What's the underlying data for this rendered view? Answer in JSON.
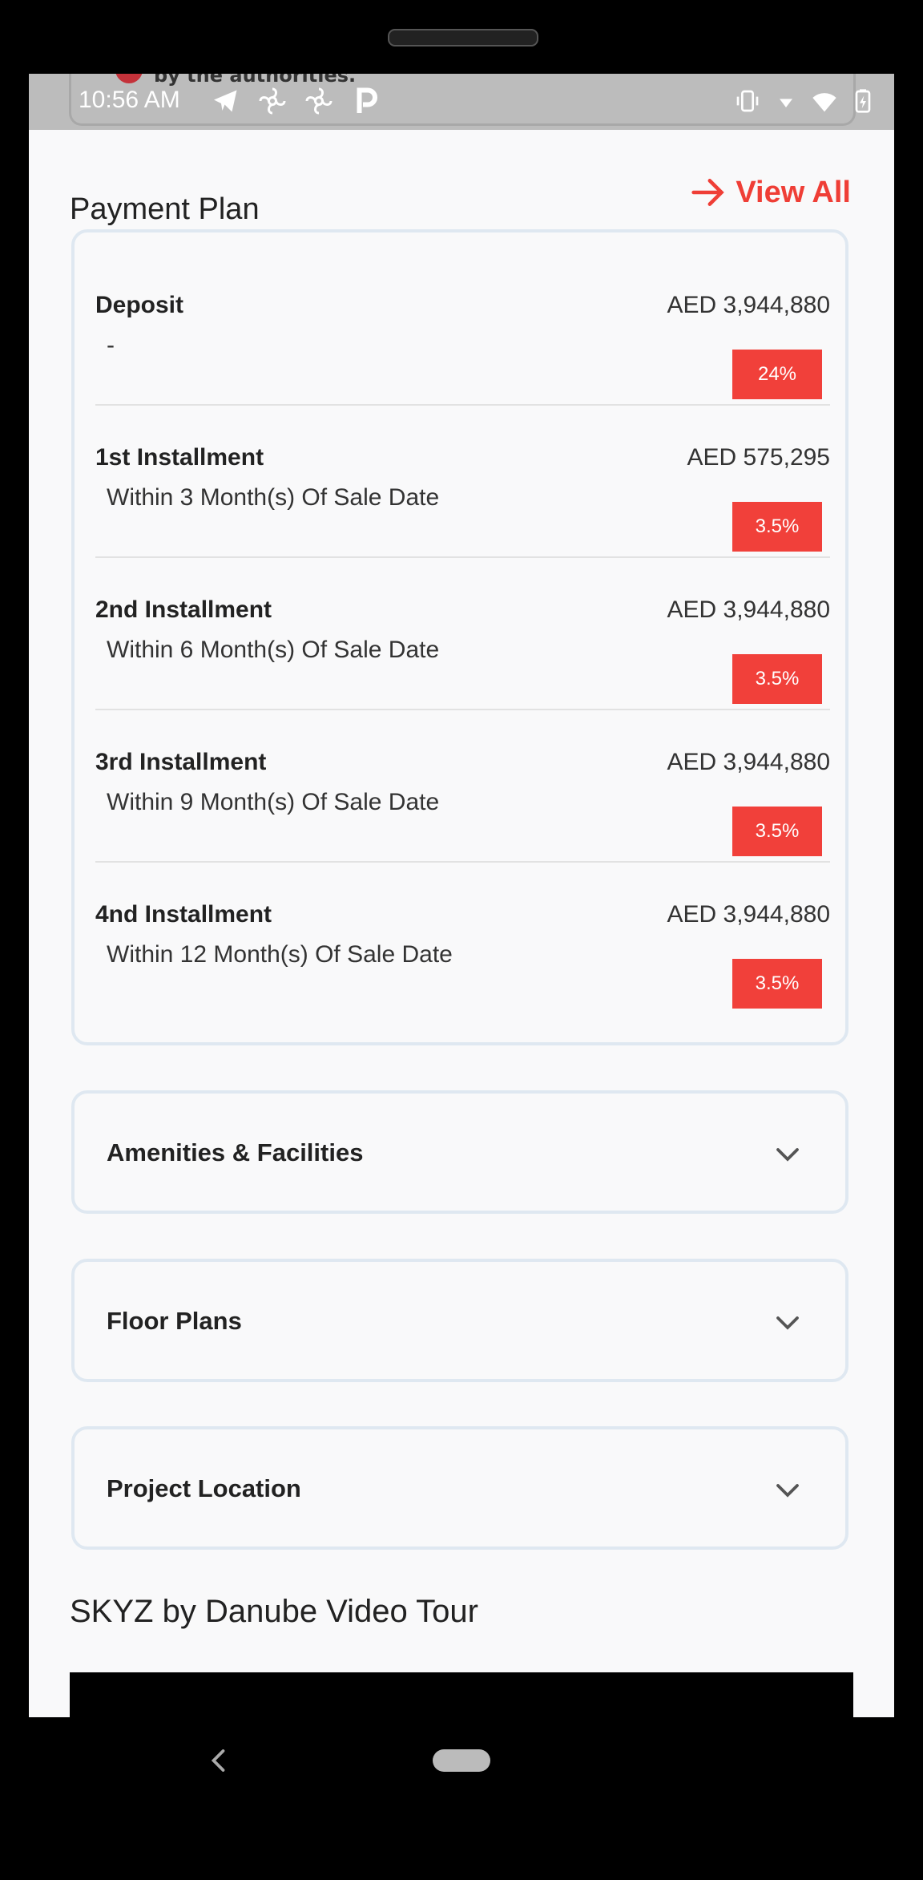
{
  "status_bar": {
    "time": "10:56 AM",
    "behind_notification_text": "by the authorities."
  },
  "payment_plan": {
    "title": "Payment Plan",
    "view_all": "View All",
    "rows": [
      {
        "name": "Deposit",
        "desc": "-",
        "amount": "AED 3,944,880",
        "percent": "24%"
      },
      {
        "name": "1st Installment",
        "desc": "Within 3 Month(s) Of Sale Date",
        "amount": "AED 575,295",
        "percent": "3.5%"
      },
      {
        "name": "2nd Installment",
        "desc": "Within 6 Month(s) Of Sale Date",
        "amount": "AED 3,944,880",
        "percent": "3.5%"
      },
      {
        "name": "3rd Installment",
        "desc": "Within 9 Month(s) Of Sale Date",
        "amount": "AED 3,944,880",
        "percent": "3.5%"
      },
      {
        "name": "4nd Installment",
        "desc": "Within 12 Month(s) Of Sale Date",
        "amount": "AED 3,944,880",
        "percent": "3.5%"
      }
    ]
  },
  "accordions": [
    {
      "label": "Amenities & Facilities"
    },
    {
      "label": "Floor Plans"
    },
    {
      "label": "Project Location"
    }
  ],
  "video_tour": {
    "title": "SKYZ by Danube Video Tour"
  },
  "colors": {
    "accent": "#ef3e36",
    "card_border": "#dfe8f1",
    "background": "#f9f9fa"
  },
  "icons": {
    "view_all": "arrow-right-icon",
    "accordion": "chevron-down-icon",
    "back": "back-icon"
  }
}
